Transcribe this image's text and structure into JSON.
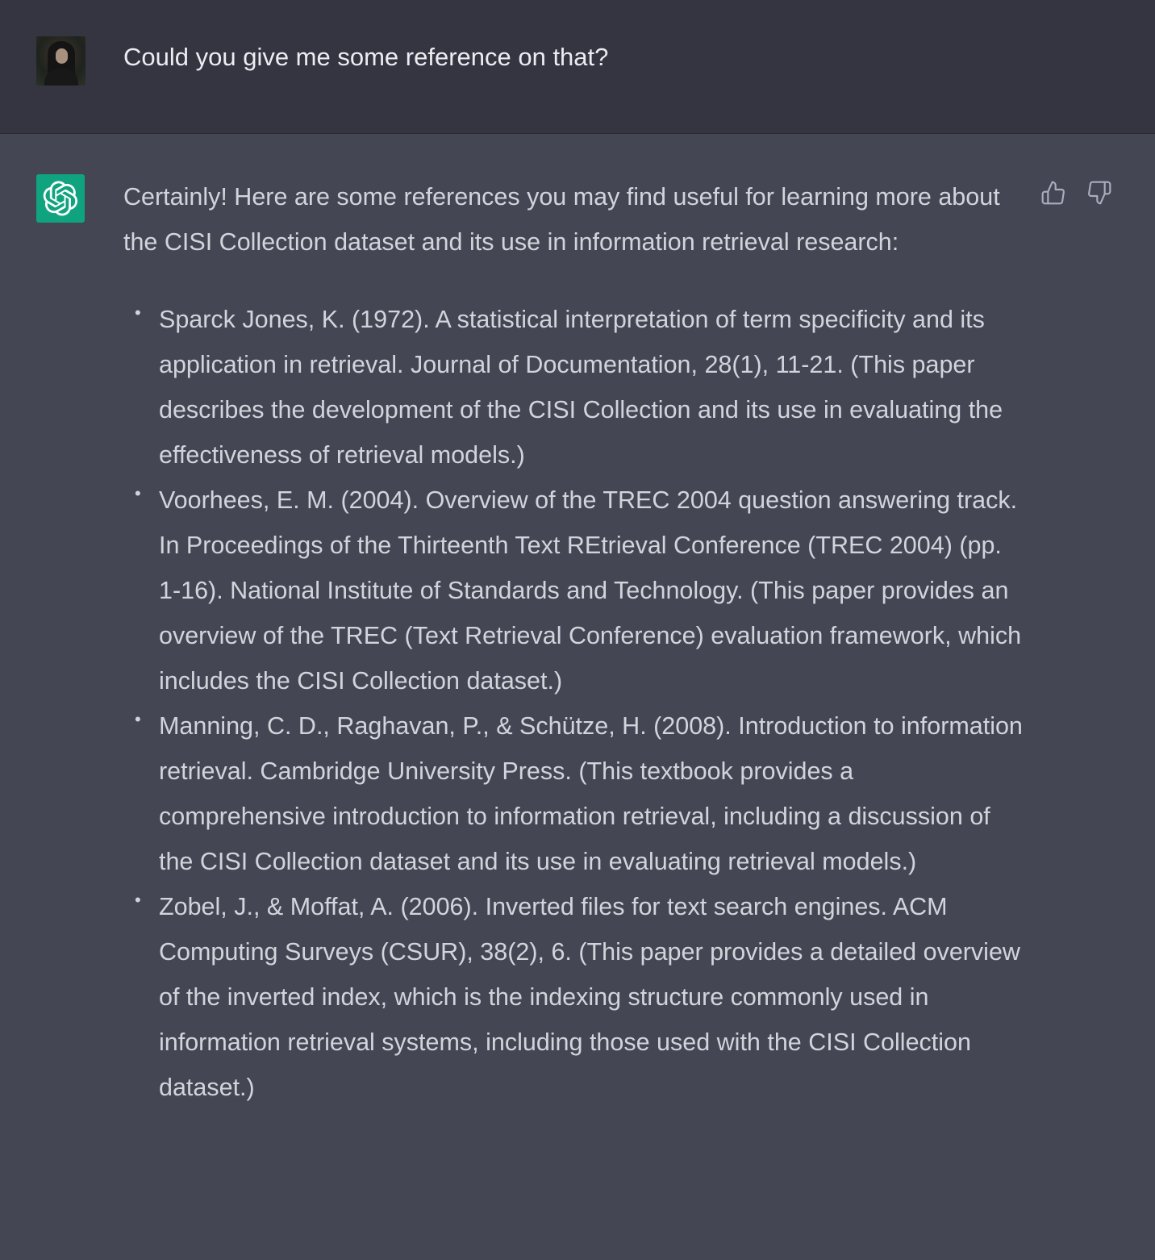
{
  "user_message": {
    "avatar_icon": "user-photo-avatar",
    "text": "Could you give me some reference on that?"
  },
  "assistant_message": {
    "avatar_icon": "openai-logo-icon",
    "brand_color": "#10a37f",
    "intro": "Certainly! Here are some references you may find useful for learning more about the CISI Collection dataset and its use in information retrieval research:",
    "references": [
      "Sparck Jones, K. (1972). A statistical interpretation of term specificity and its application in retrieval. Journal of Documentation, 28(1), 11-21. (This paper describes the development of the CISI Collection and its use in evaluating the effectiveness of retrieval models.)",
      "Voorhees, E. M. (2004). Overview of the TREC 2004 question answering track. In Proceedings of the Thirteenth Text REtrieval Conference (TREC 2004) (pp. 1-16). National Institute of Standards and Technology. (This paper provides an overview of the TREC (Text Retrieval Conference) evaluation framework, which includes the CISI Collection dataset.)",
      "Manning, C. D., Raghavan, P., & Schütze, H. (2008). Introduction to information retrieval. Cambridge University Press. (This textbook provides a comprehensive introduction to information retrieval, including a discussion of the CISI Collection dataset and its use in evaluating retrieval models.)",
      "Zobel, J., & Moffat, A. (2006). Inverted files for text search engines. ACM Computing Surveys (CSUR), 38(2), 6. (This paper provides a detailed overview of the inverted index, which is the indexing structure commonly used in information retrieval systems, including those used with the CISI Collection dataset.)"
    ],
    "feedback_icons": [
      "thumbs-up-icon",
      "thumbs-down-icon"
    ]
  },
  "colors": {
    "user_row_bg": "#343541",
    "assistant_row_bg": "#444654",
    "text": "#d1d5db"
  }
}
